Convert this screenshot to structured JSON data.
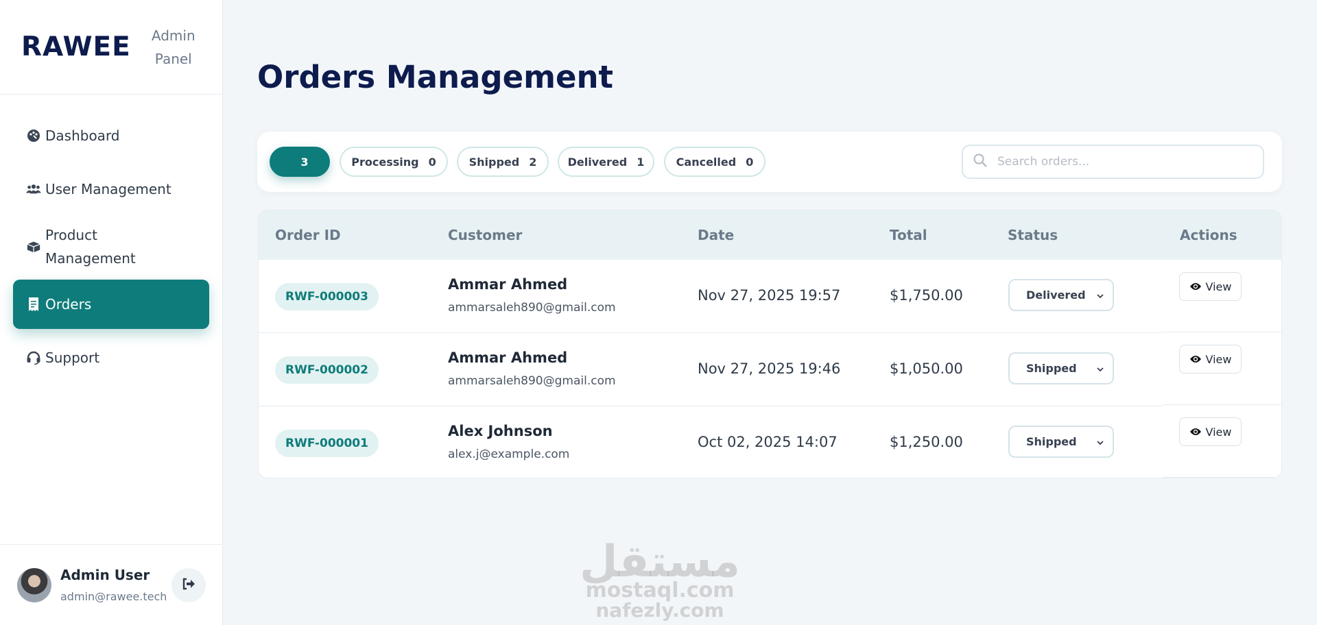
{
  "brand": {
    "name": "RAWEE",
    "subtitle": "Admin Panel"
  },
  "sidebar": {
    "items": [
      {
        "label": "Dashboard",
        "icon": "palette-icon",
        "active": false
      },
      {
        "label": "User Management",
        "icon": "users-icon",
        "active": false
      },
      {
        "label": "Product Management",
        "icon": "box-icon",
        "active": false
      },
      {
        "label": "Orders",
        "icon": "receipt-icon",
        "active": true
      },
      {
        "label": "Support",
        "icon": "headset-icon",
        "active": false
      }
    ]
  },
  "user": {
    "name": "Admin User",
    "email": "admin@rawee.tech"
  },
  "page": {
    "title": "Orders Management"
  },
  "filters": [
    {
      "label": "",
      "count": "3",
      "active": true
    },
    {
      "label": "Processing",
      "count": "0",
      "active": false
    },
    {
      "label": "Shipped",
      "count": "2",
      "active": false
    },
    {
      "label": "Delivered",
      "count": "1",
      "active": false
    },
    {
      "label": "Cancelled",
      "count": "0",
      "active": false
    }
  ],
  "search": {
    "placeholder": "Search orders...",
    "value": ""
  },
  "table": {
    "headers": [
      "Order ID",
      "Customer",
      "Date",
      "Total",
      "Status",
      "Actions"
    ],
    "rows": [
      {
        "id": "RWF-000003",
        "name": "Ammar Ahmed",
        "email": "ammarsaleh890@gmail.com",
        "date": "Nov 27, 2025 19:57",
        "total": "$1,750.00",
        "status": "Delivered",
        "action": "View"
      },
      {
        "id": "RWF-000002",
        "name": "Ammar Ahmed",
        "email": "ammarsaleh890@gmail.com",
        "date": "Nov 27, 2025 19:46",
        "total": "$1,050.00",
        "status": "Shipped",
        "action": "View"
      },
      {
        "id": "RWF-000001",
        "name": "Alex Johnson",
        "email": "alex.j@example.com",
        "date": "Oct 02, 2025 14:07",
        "total": "$1,250.00",
        "status": "Shipped",
        "action": "View"
      }
    ]
  },
  "watermark": {
    "line1": "مستقل",
    "line2": "mostaql.com",
    "line3": "nafezly.com"
  },
  "colors": {
    "accent": "#0e7c7b",
    "navy": "#0d1b4d",
    "background": "#f3f6f9"
  }
}
